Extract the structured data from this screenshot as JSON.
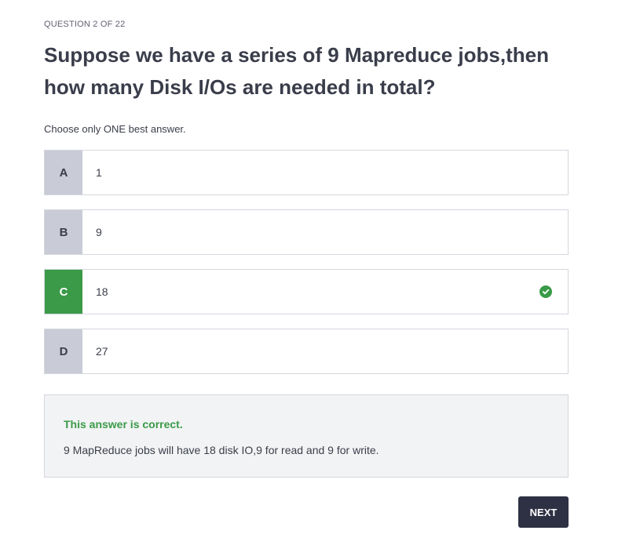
{
  "quiz": {
    "counter": "QUESTION 2 OF 22",
    "question": "Suppose we have a series of 9 Mapreduce jobs,then how many Disk I/Os are needed in total?",
    "instruction": "Choose only ONE best answer.",
    "options": [
      {
        "letter": "A",
        "text": "1"
      },
      {
        "letter": "B",
        "text": "9"
      },
      {
        "letter": "C",
        "text": "18",
        "correct": true
      },
      {
        "letter": "D",
        "text": "27"
      }
    ],
    "feedback": {
      "title": "This answer is correct.",
      "explanation": "9 MapReduce jobs will have 18 disk IO,9 for read and 9 for write."
    },
    "next_label": "NEXT"
  },
  "colors": {
    "correct": "#3a9a48",
    "letter_bg": "#c9ccd6",
    "button_bg": "#2e3143",
    "feedback_bg": "#f2f3f4"
  },
  "icons": {
    "correct_indicator": "check-circle-icon"
  }
}
